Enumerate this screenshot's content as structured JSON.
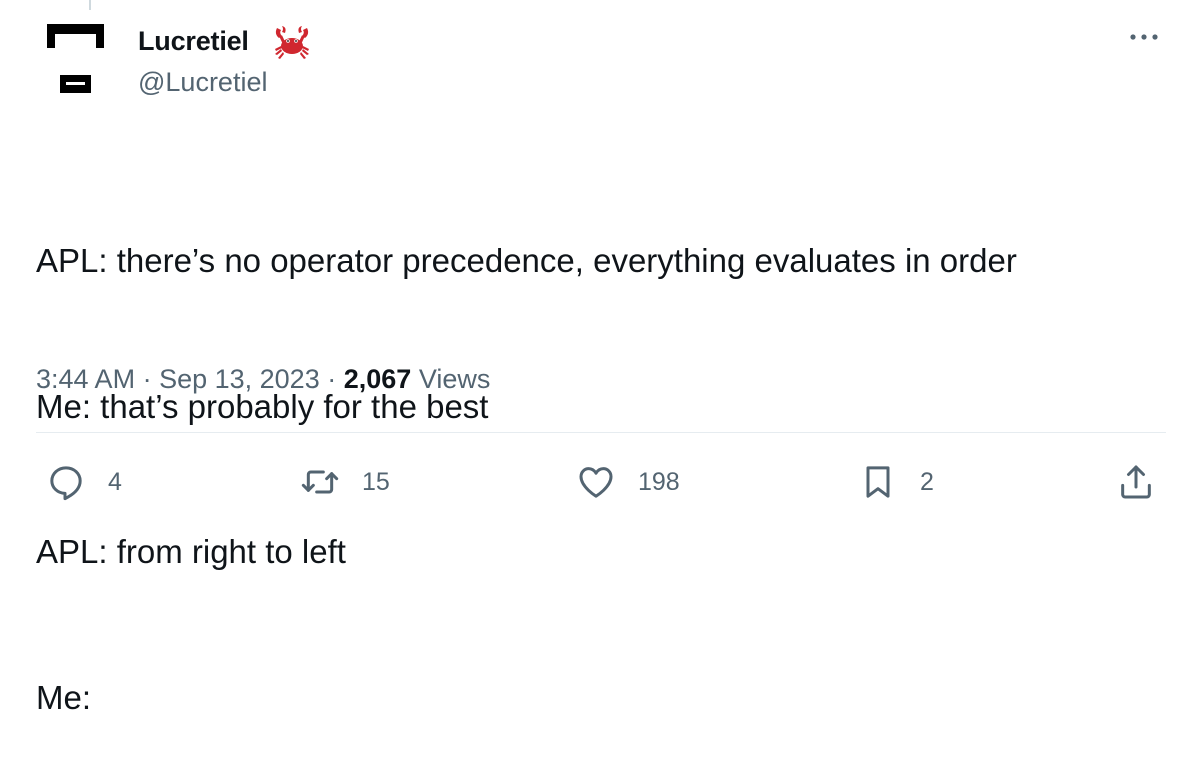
{
  "author": {
    "display_name": "Lucretiel",
    "handle": "@Lucretiel",
    "name_emoji": "crab-icon"
  },
  "tweet": {
    "lines": [
      "APL: there’s no operator precedence, everything evaluates in order",
      "Me: that’s probably for the best",
      "APL: from right to left",
      "Me:"
    ],
    "time": "3:44 AM",
    "date": "Sep 13, 2023",
    "views_count": "2,067",
    "views_label": "Views",
    "separator": " · "
  },
  "actions": {
    "replies": "4",
    "retweets": "15",
    "likes": "198",
    "bookmarks": "2"
  },
  "colors": {
    "text": "#0f1419",
    "secondary": "#536471",
    "divider": "#e6ecf0",
    "crab": "#d0272f"
  }
}
